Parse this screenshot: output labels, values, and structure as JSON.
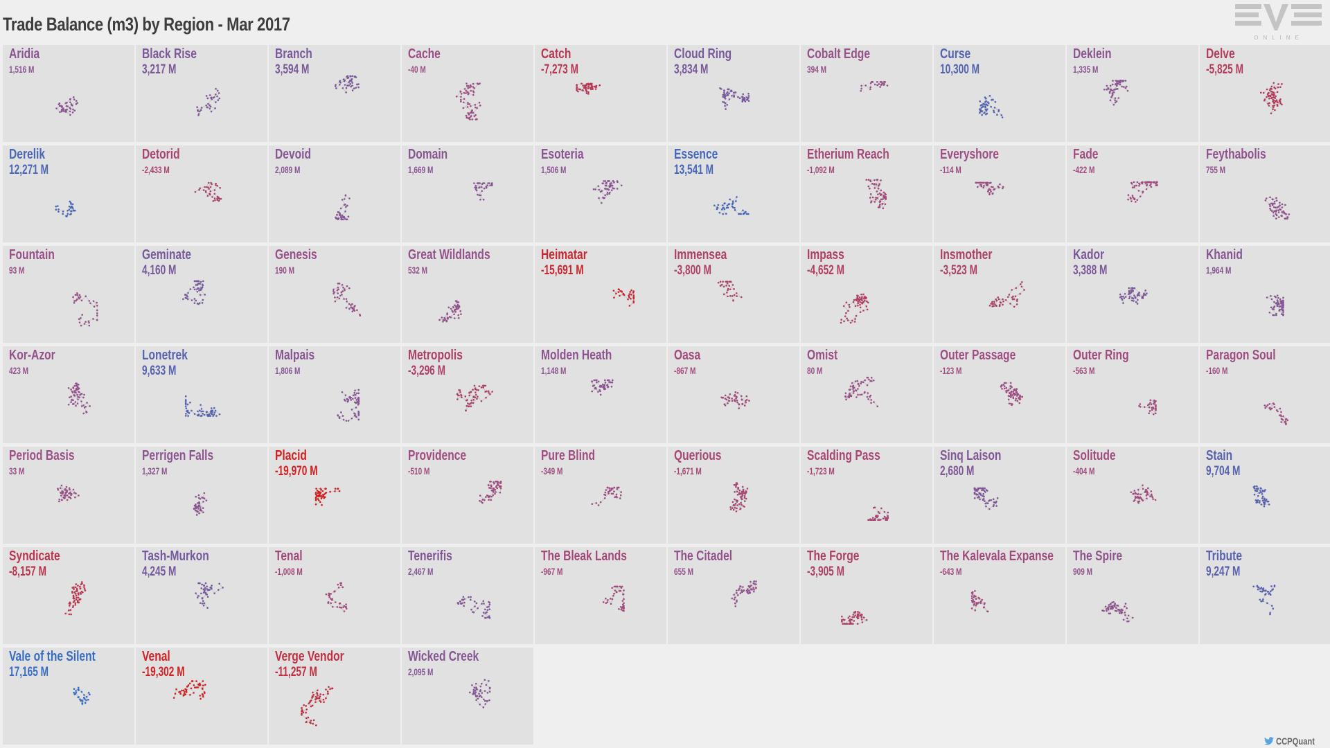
{
  "header": {
    "title": "Trade Balance (m3) by Region - Mar 2017",
    "logo_text": "EVE",
    "logo_subtext": "ONLINE"
  },
  "footer": {
    "credit": "CCPQuant",
    "credit_icon": "twitter-bird-icon"
  },
  "colors": {
    "most_positive": "#2a6fc9",
    "neutral": "#9c4f86",
    "most_negative": "#d21f1f",
    "cell_bg": "#e1e1e1",
    "page_bg": "#efefef"
  },
  "chart_data": {
    "type": "table",
    "title": "Trade Balance (m3) by Region - Mar 2017",
    "unit": "M m3",
    "layout": "small-multiples grid, 10 columns, alphabetical",
    "color_scale": "diverging: blue = positive, purple = near zero, red = negative",
    "regions": [
      {
        "name": "Aridia",
        "label": "1,516 M",
        "value": 1516
      },
      {
        "name": "Black Rise",
        "label": "3,217 M",
        "value": 3217
      },
      {
        "name": "Branch",
        "label": "3,594 M",
        "value": 3594
      },
      {
        "name": "Cache",
        "label": "-40 M",
        "value": -40
      },
      {
        "name": "Catch",
        "label": "-7,273 M",
        "value": -7273
      },
      {
        "name": "Cloud Ring",
        "label": "3,834 M",
        "value": 3834
      },
      {
        "name": "Cobalt Edge",
        "label": "394 M",
        "value": 394
      },
      {
        "name": "Curse",
        "label": "10,300 M",
        "value": 10300
      },
      {
        "name": "Deklein",
        "label": "1,335 M",
        "value": 1335
      },
      {
        "name": "Delve",
        "label": "-5,825 M",
        "value": -5825
      },
      {
        "name": "Derelik",
        "label": "12,271 M",
        "value": 12271
      },
      {
        "name": "Detorid",
        "label": "-2,433 M",
        "value": -2433
      },
      {
        "name": "Devoid",
        "label": "2,089 M",
        "value": 2089
      },
      {
        "name": "Domain",
        "label": "1,669 M",
        "value": 1669
      },
      {
        "name": "Esoteria",
        "label": "1,506 M",
        "value": 1506
      },
      {
        "name": "Essence",
        "label": "13,541 M",
        "value": 13541
      },
      {
        "name": "Etherium Reach",
        "label": "-1,092 M",
        "value": -1092
      },
      {
        "name": "Everyshore",
        "label": "-114 M",
        "value": -114
      },
      {
        "name": "Fade",
        "label": "-422 M",
        "value": -422
      },
      {
        "name": "Feythabolis",
        "label": "755 M",
        "value": 755
      },
      {
        "name": "Fountain",
        "label": "93 M",
        "value": 93
      },
      {
        "name": "Geminate",
        "label": "4,160 M",
        "value": 4160
      },
      {
        "name": "Genesis",
        "label": "190 M",
        "value": 190
      },
      {
        "name": "Great Wildlands",
        "label": "532 M",
        "value": 532
      },
      {
        "name": "Heimatar",
        "label": "-15,691 M",
        "value": -15691
      },
      {
        "name": "Immensea",
        "label": "-3,800 M",
        "value": -3800
      },
      {
        "name": "Impass",
        "label": "-4,652 M",
        "value": -4652
      },
      {
        "name": "Insmother",
        "label": "-3,523 M",
        "value": -3523
      },
      {
        "name": "Kador",
        "label": "3,388 M",
        "value": 3388
      },
      {
        "name": "Khanid",
        "label": "1,964 M",
        "value": 1964
      },
      {
        "name": "Kor-Azor",
        "label": "423 M",
        "value": 423
      },
      {
        "name": "Lonetrek",
        "label": "9,633 M",
        "value": 9633
      },
      {
        "name": "Malpais",
        "label": "1,806 M",
        "value": 1806
      },
      {
        "name": "Metropolis",
        "label": "-3,296 M",
        "value": -3296
      },
      {
        "name": "Molden Heath",
        "label": "1,148 M",
        "value": 1148
      },
      {
        "name": "Oasa",
        "label": "-867 M",
        "value": -867
      },
      {
        "name": "Omist",
        "label": "80 M",
        "value": 80
      },
      {
        "name": "Outer Passage",
        "label": "-123 M",
        "value": -123
      },
      {
        "name": "Outer Ring",
        "label": "-563 M",
        "value": -563
      },
      {
        "name": "Paragon Soul",
        "label": "-160 M",
        "value": -160
      },
      {
        "name": "Period Basis",
        "label": "33 M",
        "value": 33
      },
      {
        "name": "Perrigen Falls",
        "label": "1,327 M",
        "value": 1327
      },
      {
        "name": "Placid",
        "label": "-19,970 M",
        "value": -19970
      },
      {
        "name": "Providence",
        "label": "-510 M",
        "value": -510
      },
      {
        "name": "Pure Blind",
        "label": "-349 M",
        "value": -349
      },
      {
        "name": "Querious",
        "label": "-1,671 M",
        "value": -1671
      },
      {
        "name": "Scalding Pass",
        "label": "-1,723 M",
        "value": -1723
      },
      {
        "name": "Sinq Laison",
        "label": "2,680 M",
        "value": 2680
      },
      {
        "name": "Solitude",
        "label": "-404 M",
        "value": -404
      },
      {
        "name": "Stain",
        "label": "9,704 M",
        "value": 9704
      },
      {
        "name": "Syndicate",
        "label": "-8,157 M",
        "value": -8157
      },
      {
        "name": "Tash-Murkon",
        "label": "4,245 M",
        "value": 4245
      },
      {
        "name": "Tenal",
        "label": "-1,008 M",
        "value": -1008
      },
      {
        "name": "Tenerifis",
        "label": "2,467 M",
        "value": 2467
      },
      {
        "name": "The Bleak Lands",
        "label": "-967 M",
        "value": -967
      },
      {
        "name": "The Citadel",
        "label": "655 M",
        "value": 655
      },
      {
        "name": "The Forge",
        "label": "-3,905 M",
        "value": -3905
      },
      {
        "name": "The Kalevala Expanse",
        "label": "-643 M",
        "value": -643
      },
      {
        "name": "The Spire",
        "label": "909 M",
        "value": 909
      },
      {
        "name": "Tribute",
        "label": "9,247 M",
        "value": 9247
      },
      {
        "name": "Vale of the Silent",
        "label": "17,165 M",
        "value": 17165
      },
      {
        "name": "Venal",
        "label": "-19,302 M",
        "value": -19302
      },
      {
        "name": "Verge Vendor",
        "label": "-11,257 M",
        "value": -11257
      },
      {
        "name": "Wicked Creek",
        "label": "2,095 M",
        "value": 2095
      }
    ]
  }
}
